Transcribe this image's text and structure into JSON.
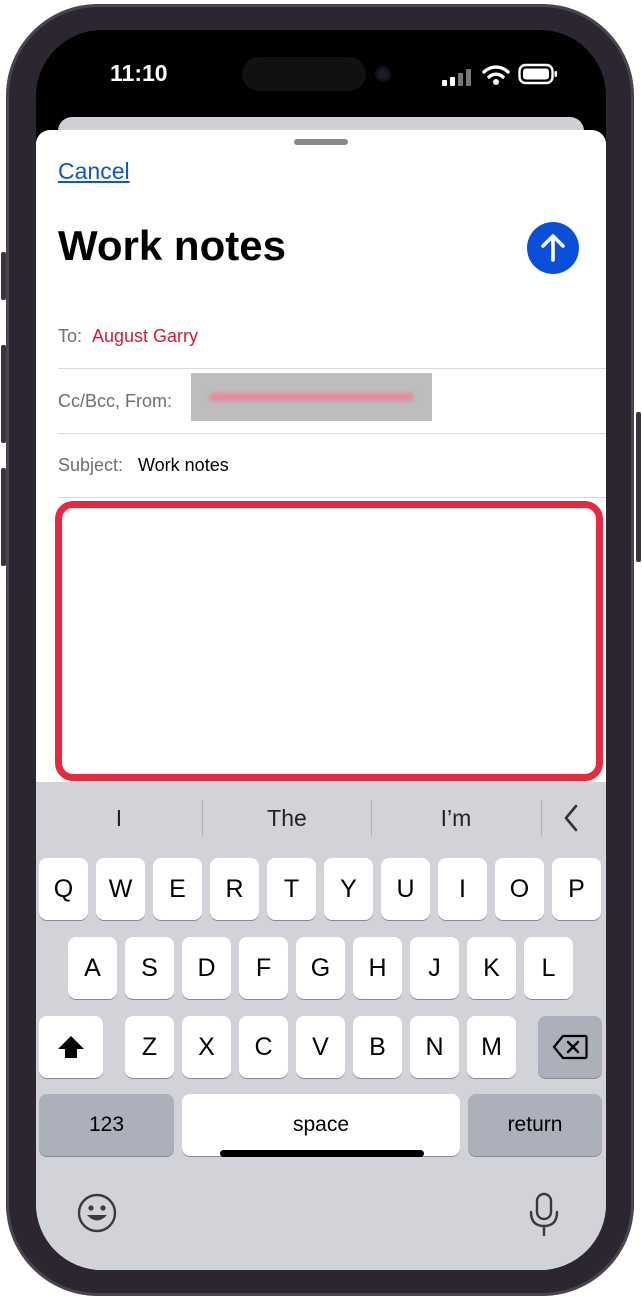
{
  "status": {
    "time": "11:10"
  },
  "compose": {
    "cancel_label": "Cancel",
    "title": "Work notes",
    "to_label": "To:",
    "to_value": "August Garry",
    "ccbcc_label": "Cc/Bcc, From:",
    "subject_label": "Subject:",
    "subject_value": "Work notes"
  },
  "keyboard": {
    "suggestions": [
      "I",
      "The",
      "I’m"
    ],
    "row1": [
      "Q",
      "W",
      "E",
      "R",
      "T",
      "Y",
      "U",
      "I",
      "O",
      "P"
    ],
    "row2": [
      "A",
      "S",
      "D",
      "F",
      "G",
      "H",
      "J",
      "K",
      "L"
    ],
    "row3": [
      "Z",
      "X",
      "C",
      "V",
      "B",
      "N",
      "M"
    ],
    "numbers_label": "123",
    "space_label": "space",
    "return_label": "return"
  },
  "colors": {
    "accent": "#0a4fd9",
    "highlight": "#e9283f",
    "recipient": "#d11b3a"
  }
}
